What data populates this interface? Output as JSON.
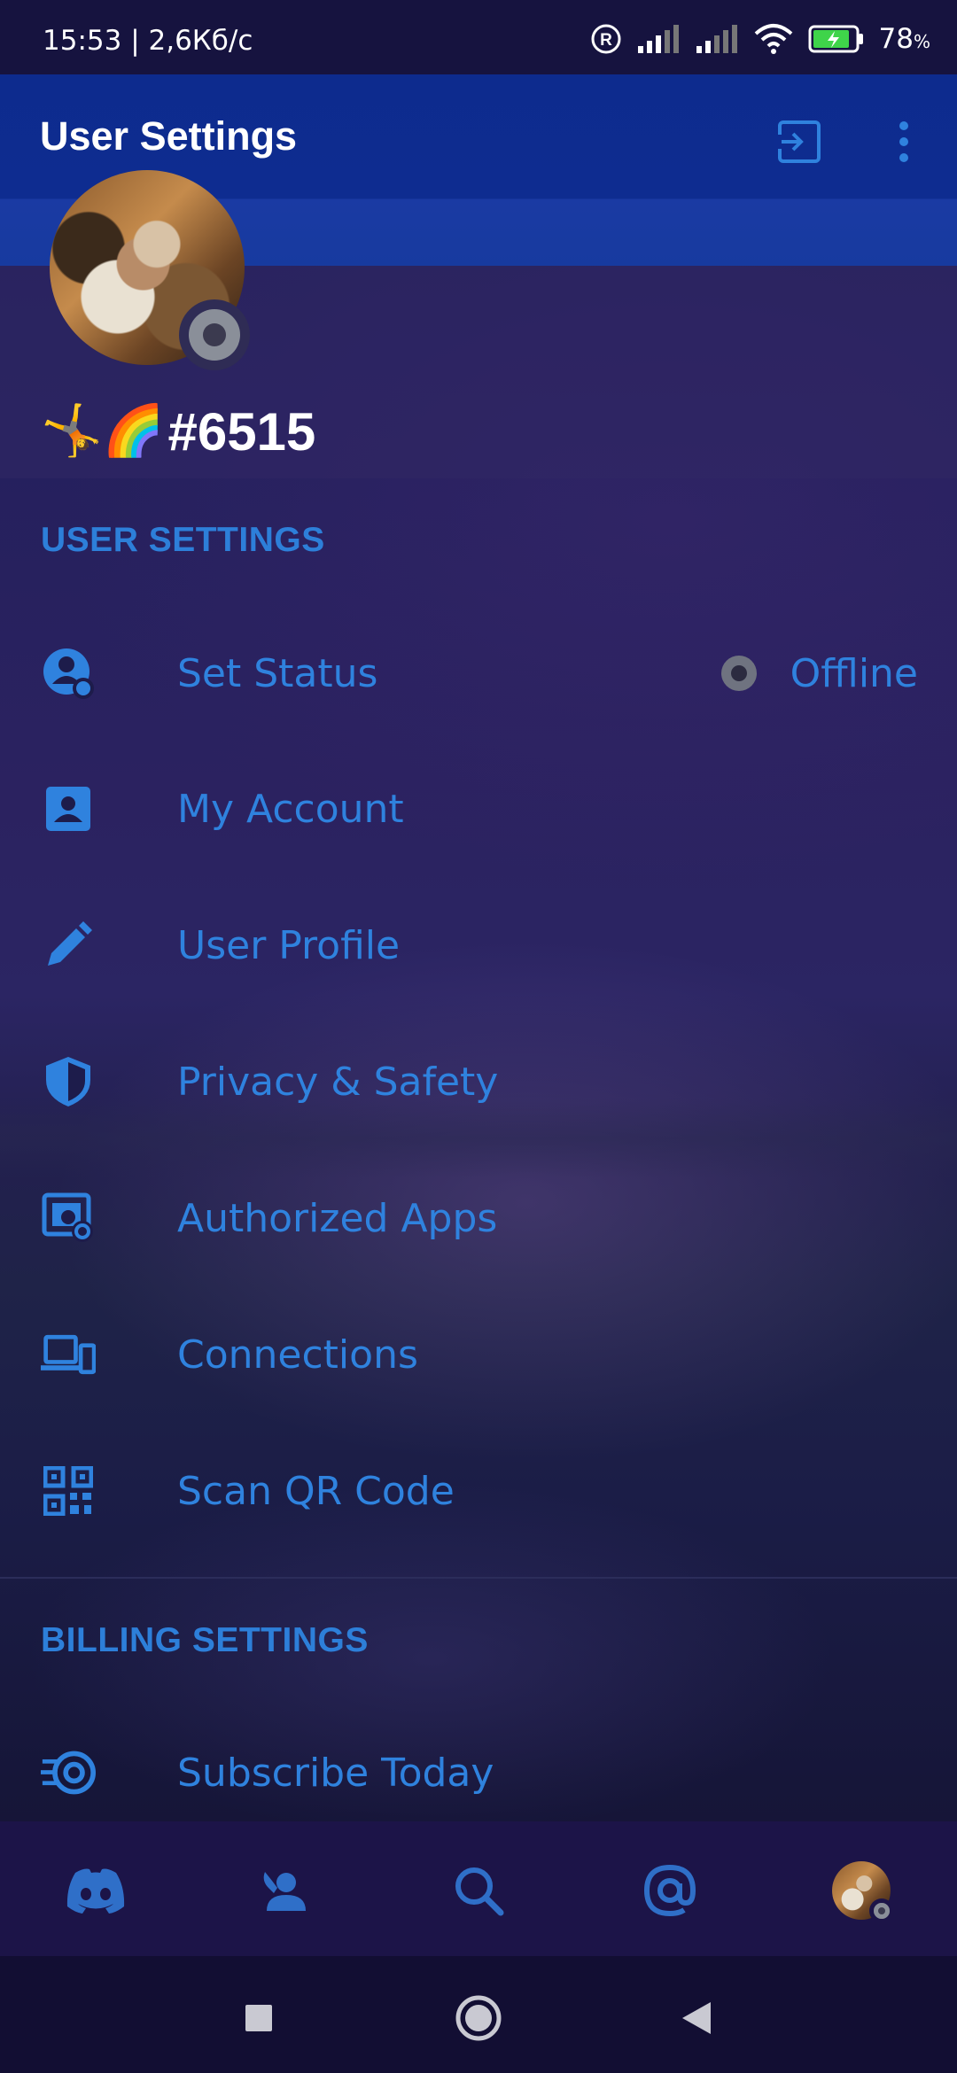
{
  "status_bar": {
    "time": "15:53 | 2,6Кб/с",
    "battery": "78",
    "battery_unit": "%"
  },
  "header": {
    "title": "User Settings",
    "logout_icon": "logout-icon",
    "more_icon": "more-vertical-icon"
  },
  "profile": {
    "emojis": "🤸🌈",
    "tag": "#6515",
    "status": "offline"
  },
  "user_settings": {
    "heading": "USER SETTINGS",
    "items": [
      {
        "label": "Set Status",
        "icon": "set-status-icon",
        "value": "Offline"
      },
      {
        "label": "My Account",
        "icon": "account-icon"
      },
      {
        "label": "User Profile",
        "icon": "pencil-icon"
      },
      {
        "label": "Privacy & Safety",
        "icon": "shield-icon"
      },
      {
        "label": "Authorized Apps",
        "icon": "authorized-apps-icon"
      },
      {
        "label": "Connections",
        "icon": "devices-icon"
      },
      {
        "label": "Scan QR Code",
        "icon": "qr-code-icon"
      }
    ]
  },
  "billing_settings": {
    "heading": "BILLING SETTINGS",
    "items": [
      {
        "label": "Subscribe Today",
        "icon": "nitro-icon"
      }
    ]
  },
  "bottom_nav": {
    "items": [
      "discord-home-icon",
      "friends-icon",
      "search-icon",
      "mentions-icon",
      "profile-avatar"
    ]
  },
  "colors": {
    "accent": "#2f82de",
    "header": "#0d2b8e",
    "background": "#1f1a55"
  }
}
